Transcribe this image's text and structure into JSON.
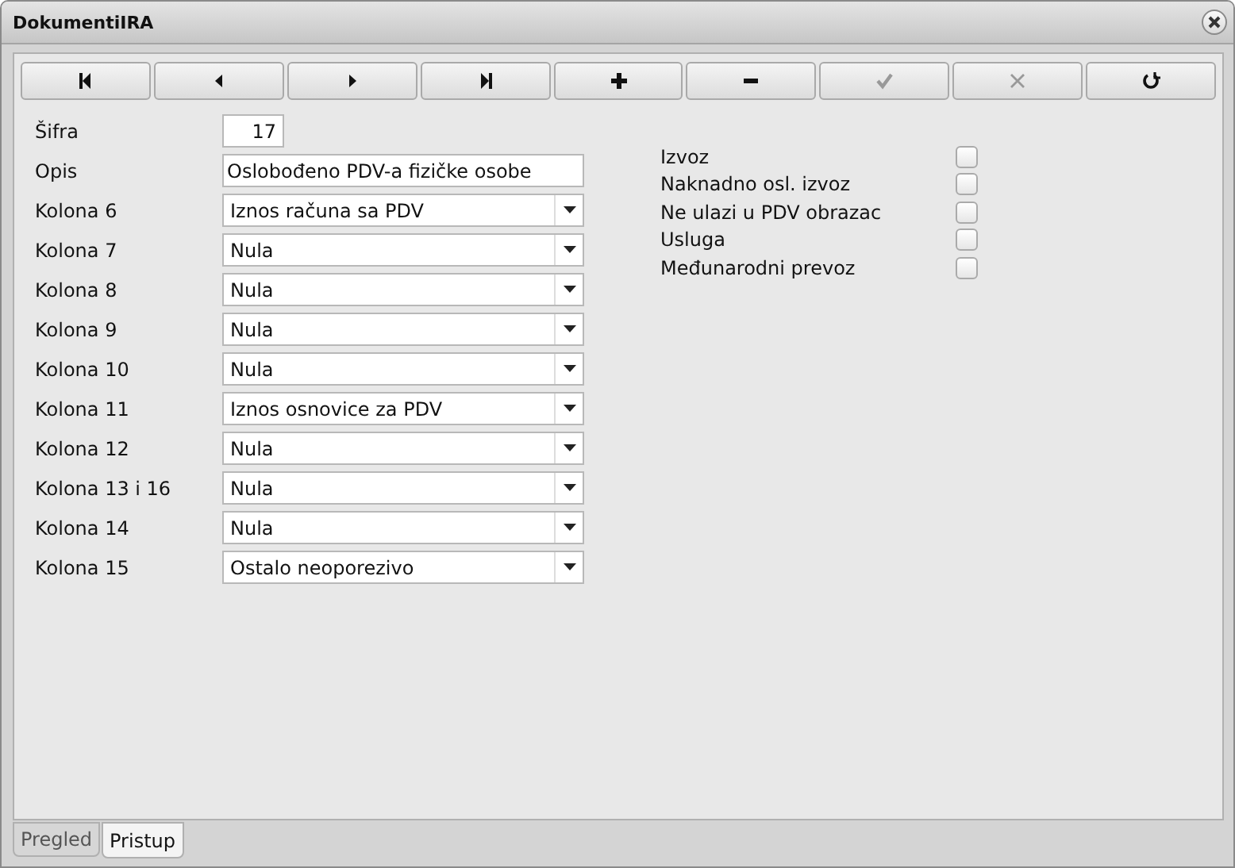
{
  "window": {
    "title": "DokumentiIRA"
  },
  "toolbar": [
    {
      "kind": "first",
      "disabled": false
    },
    {
      "kind": "prev",
      "disabled": false
    },
    {
      "kind": "next",
      "disabled": false
    },
    {
      "kind": "last",
      "disabled": false
    },
    {
      "kind": "add",
      "disabled": false
    },
    {
      "kind": "remove",
      "disabled": false
    },
    {
      "kind": "save",
      "disabled": true
    },
    {
      "kind": "cancel",
      "disabled": true
    },
    {
      "kind": "refresh",
      "disabled": false
    }
  ],
  "fields": [
    {
      "kind": "number",
      "label": "Šifra",
      "value": "17"
    },
    {
      "kind": "text",
      "label": "Opis",
      "value": "Oslobođeno PDV-a fizičke osobe"
    },
    {
      "kind": "select",
      "label": "Kolona 6",
      "value": "Iznos računa sa PDV"
    },
    {
      "kind": "select",
      "label": "Kolona 7",
      "value": "Nula"
    },
    {
      "kind": "select",
      "label": "Kolona 8",
      "value": "Nula"
    },
    {
      "kind": "select",
      "label": "Kolona 9",
      "value": "Nula"
    },
    {
      "kind": "select",
      "label": "Kolona 10",
      "value": "Nula"
    },
    {
      "kind": "select",
      "label": "Kolona 11",
      "value": "Iznos osnovice za PDV"
    },
    {
      "kind": "select",
      "label": "Kolona 12",
      "value": "Nula"
    },
    {
      "kind": "select",
      "label": "Kolona 13 i 16",
      "value": "Nula"
    },
    {
      "kind": "select",
      "label": "Kolona 14",
      "value": "Nula"
    },
    {
      "kind": "select",
      "label": "Kolona 15",
      "value": "Ostalo neoporezivo"
    }
  ],
  "checkboxes": [
    {
      "label": "Izvoz",
      "checked": false
    },
    {
      "label": "Naknadno osl. izvoz",
      "checked": false
    },
    {
      "label": "Ne ulazi u PDV obrazac",
      "checked": false
    },
    {
      "label": "Usluga",
      "checked": false
    },
    {
      "label": "Međunarodni prevoz",
      "checked": false
    }
  ],
  "tabs": [
    {
      "label": "Pregled",
      "selected": false
    },
    {
      "label": "Pristup",
      "selected": true
    }
  ]
}
